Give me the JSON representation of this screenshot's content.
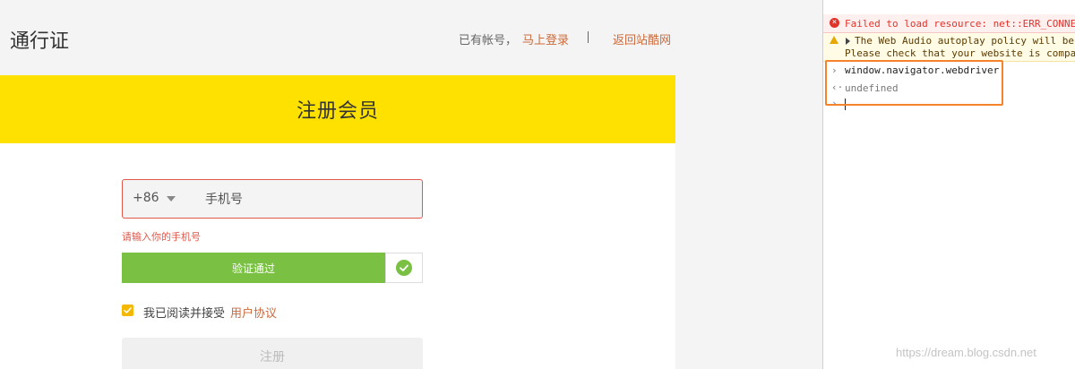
{
  "header": {
    "brand": "通行证",
    "have_account": "已有帐号，",
    "login_link": "马上登录",
    "back_link": "返回站酷网"
  },
  "banner": {
    "title": "注册会员"
  },
  "form": {
    "country_code": "+86",
    "phone_placeholder": "手机号",
    "phone_error": "请输入你的手机号",
    "captcha_label": "验证通过",
    "agree_text": "我已阅读并接受",
    "agree_link": "用户协议",
    "register_label": "注册"
  },
  "console": {
    "error": "Failed to load resource: net::ERR_CONNE",
    "warning_line1": "The Web Audio autoplay policy will be",
    "warning_line2": "Please check that your website is compa",
    "command": "window.navigator.webdriver",
    "result": "undefined"
  },
  "watermark": "https://dream.blog.csdn.net",
  "colors": {
    "banner": "#ffe100",
    "link": "#cb6a3c",
    "error": "#e0574b",
    "captcha": "#7ac143",
    "highlight": "#f4832b"
  },
  "icons": [
    "chevron-down-icon",
    "check-circle-icon",
    "checkbox-checked-icon",
    "error-icon",
    "warning-icon",
    "expand-caret-icon",
    "prompt-icon",
    "result-icon"
  ]
}
